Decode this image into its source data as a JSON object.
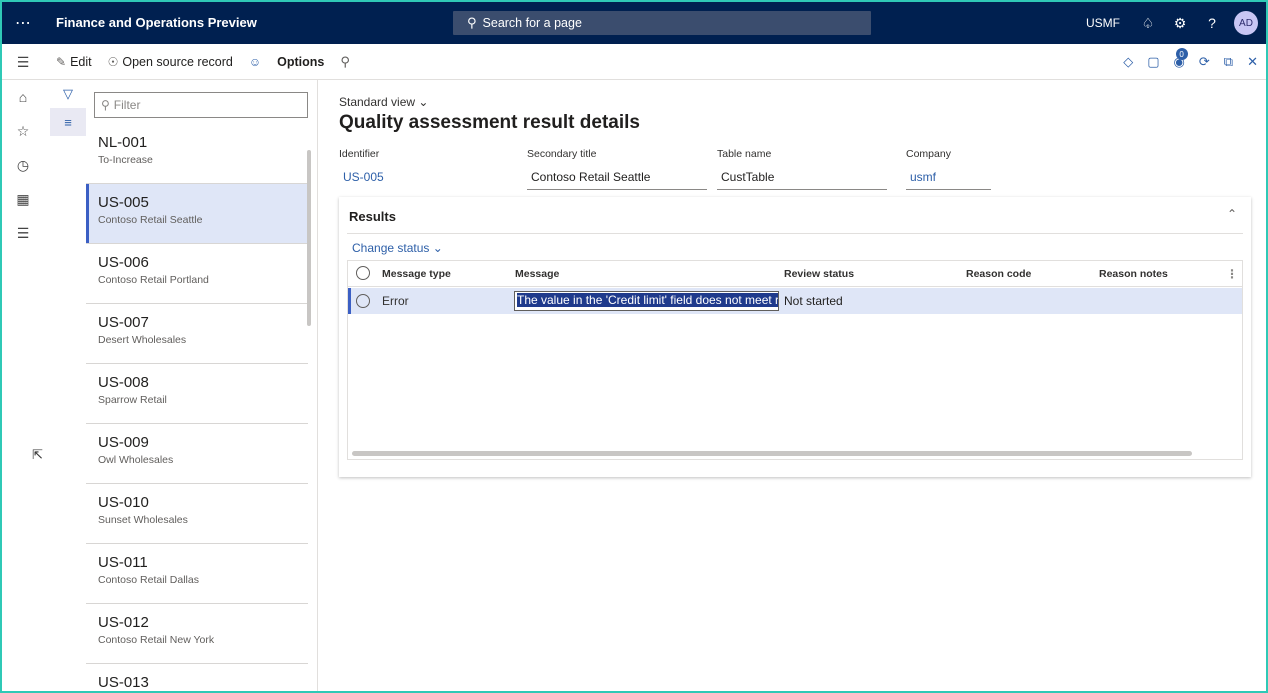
{
  "topbar": {
    "app_title": "Finance and Operations Preview",
    "search_placeholder": "Search for a page",
    "company": "USMF",
    "avatar_initials": "AD"
  },
  "actionpane": {
    "edit_label": "Edit",
    "open_source_label": "Open source record",
    "options_label": "Options",
    "notification_count": "0"
  },
  "list": {
    "filter_placeholder": "Filter",
    "records": [
      {
        "id": "NL-001",
        "name": "To-Increase"
      },
      {
        "id": "US-005",
        "name": "Contoso Retail Seattle"
      },
      {
        "id": "US-006",
        "name": "Contoso Retail Portland"
      },
      {
        "id": "US-007",
        "name": "Desert Wholesales"
      },
      {
        "id": "US-008",
        "name": "Sparrow Retail"
      },
      {
        "id": "US-009",
        "name": "Owl Wholesales"
      },
      {
        "id": "US-010",
        "name": "Sunset Wholesales"
      },
      {
        "id": "US-011",
        "name": "Contoso Retail Dallas"
      },
      {
        "id": "US-012",
        "name": "Contoso Retail New York"
      },
      {
        "id": "US-013",
        "name": ""
      }
    ],
    "selected_index": 1
  },
  "main": {
    "view_selector": "Standard view",
    "page_title": "Quality assessment result details",
    "fields": {
      "identifier_label": "Identifier",
      "identifier_value": "US-005",
      "secondary_title_label": "Secondary title",
      "secondary_title_value": "Contoso Retail Seattle",
      "table_name_label": "Table name",
      "table_name_value": "CustTable",
      "company_label": "Company",
      "company_value": "usmf"
    },
    "results": {
      "header": "Results",
      "change_status_label": "Change status",
      "columns": [
        "Message type",
        "Message",
        "Review status",
        "Reason code",
        "Reason notes"
      ],
      "rows": [
        {
          "message_type": "Error",
          "message": "The value in the 'Credit limit' field does not meet ra",
          "review_status": "Not started",
          "reason_code": "",
          "reason_notes": ""
        }
      ]
    }
  },
  "colors": {
    "topbar_bg": "#002050",
    "accent": "#2d5fa8",
    "selected_bg": "#dfe6f7",
    "frame_border": "#2fc9b6"
  }
}
